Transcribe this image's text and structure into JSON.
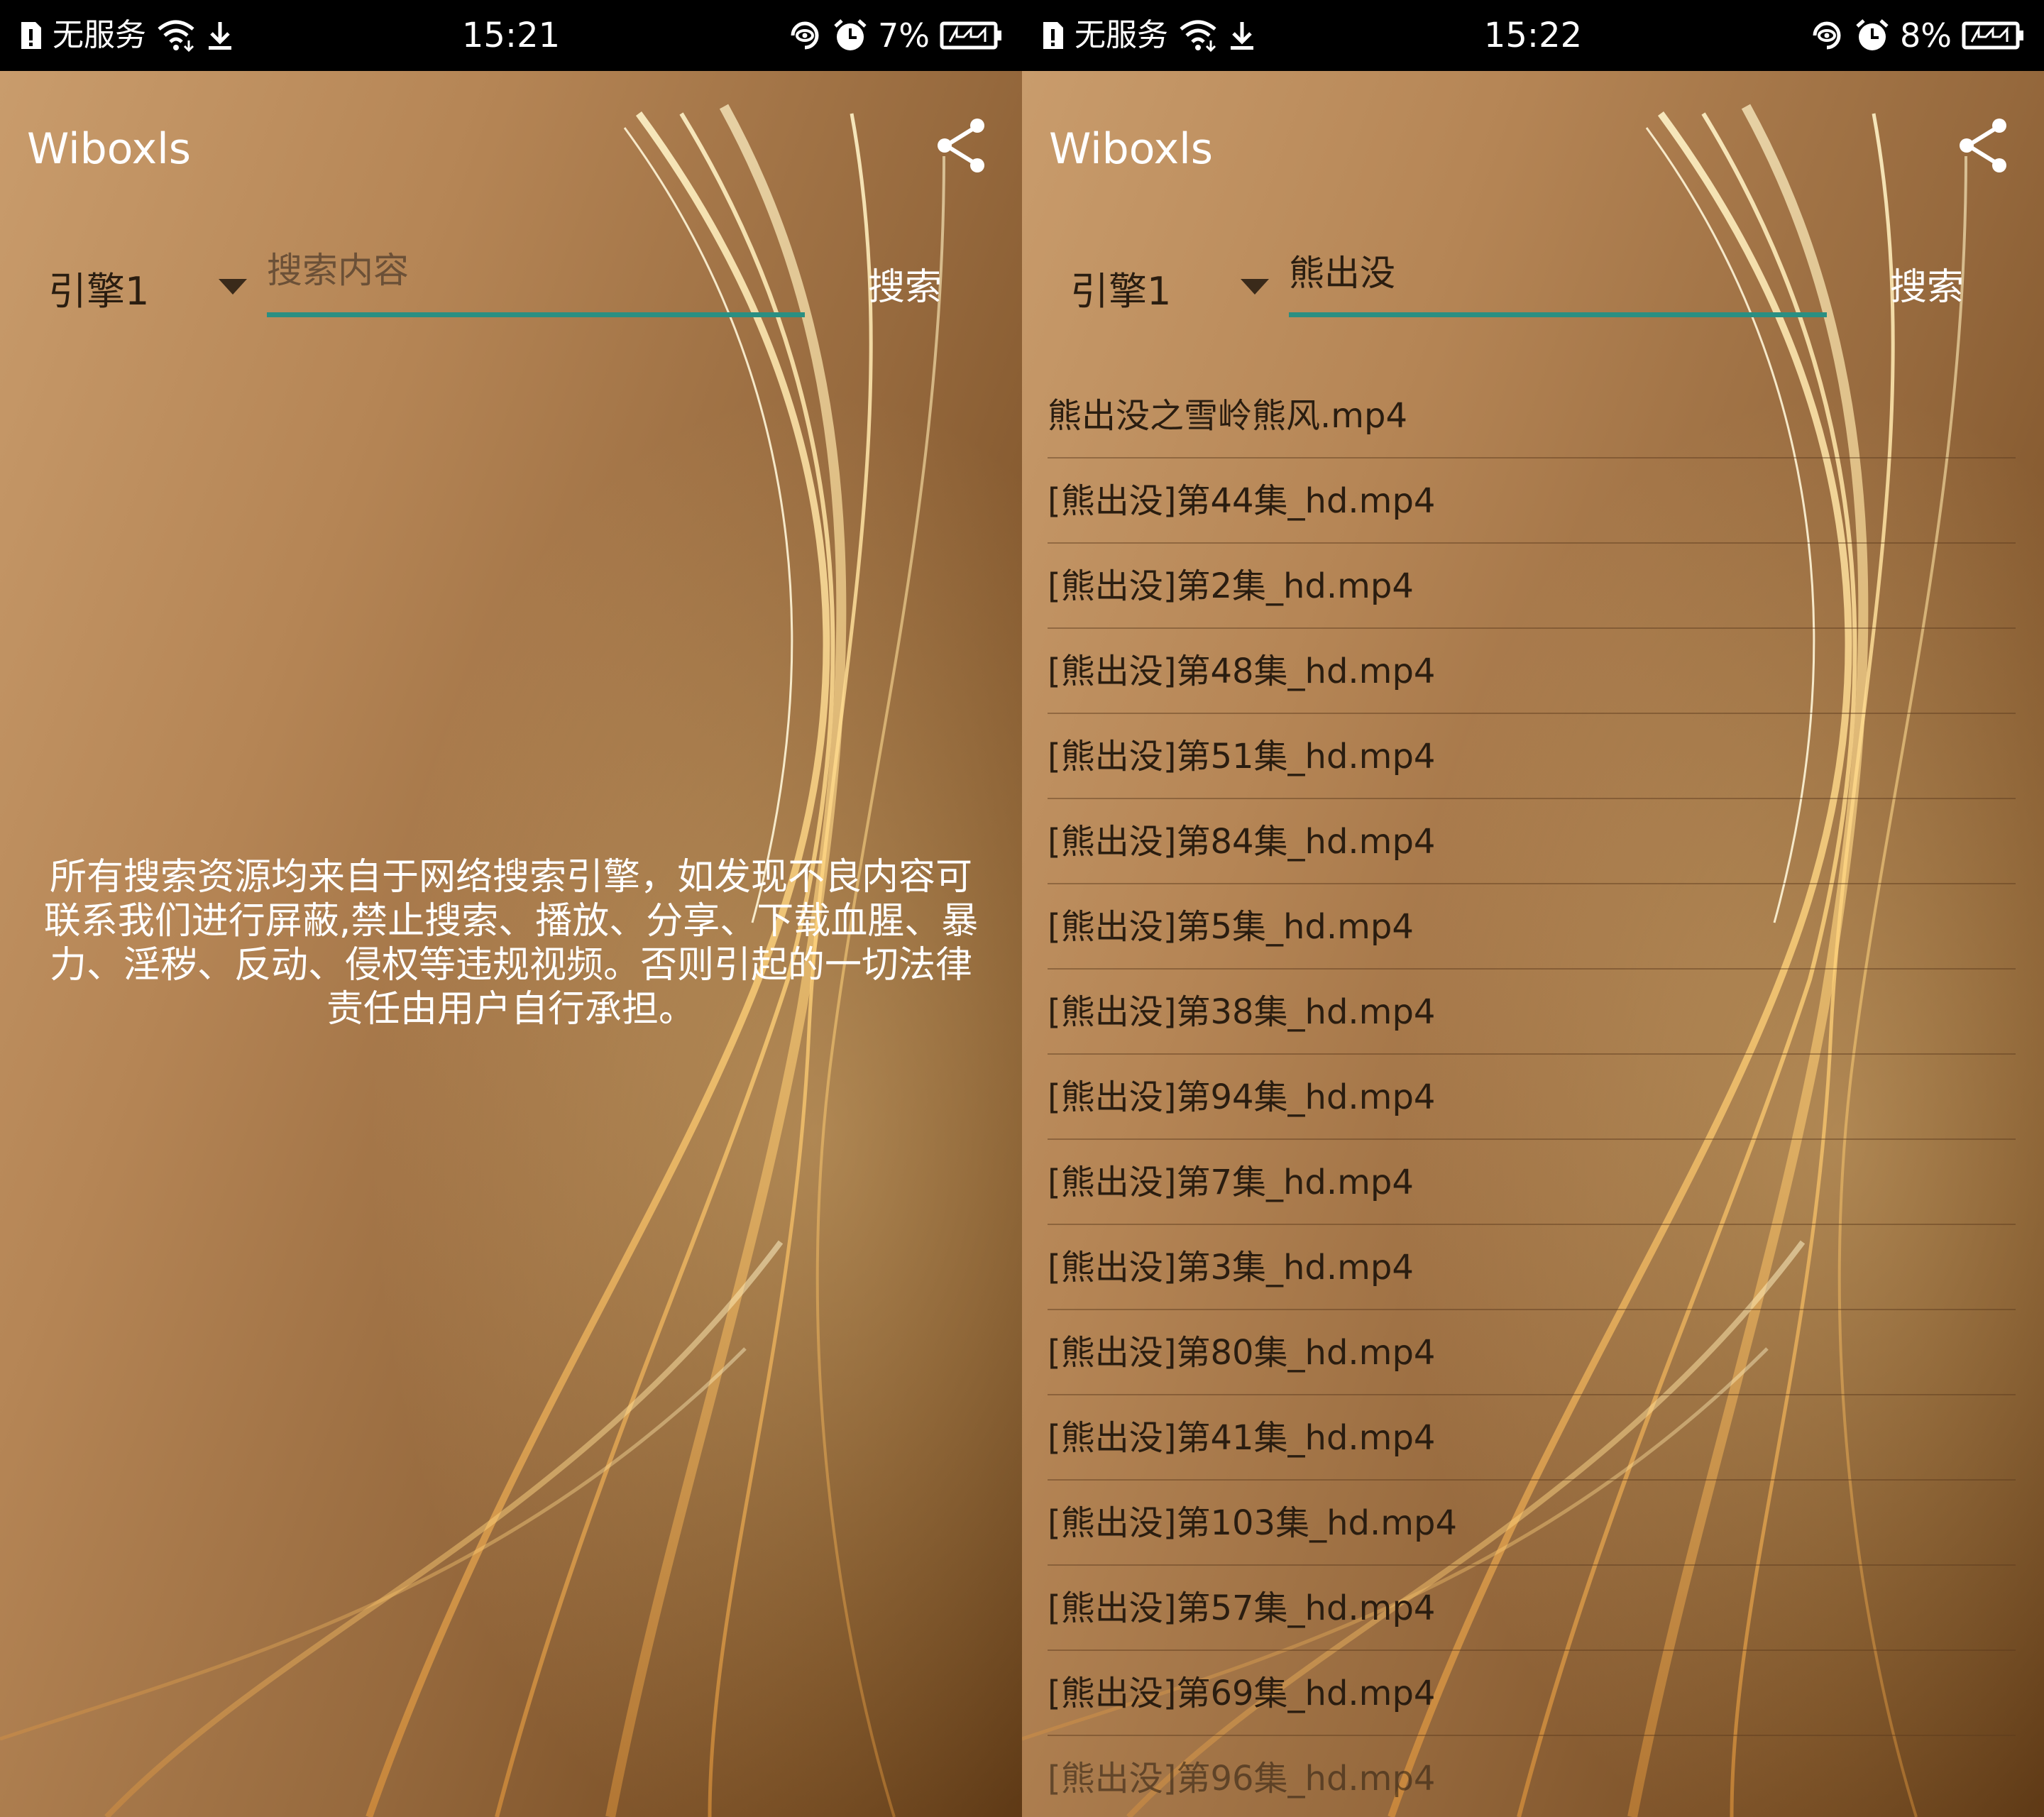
{
  "left": {
    "status": {
      "carrier": "无服务",
      "time": "15:21",
      "battery": "7%"
    },
    "app_title": "Wiboxls",
    "engine": "引擎1",
    "search": {
      "value": "",
      "placeholder": "搜索内容",
      "button": "搜索"
    },
    "notice": "所有搜索资源均来自于网络搜索引擎，如发现不良内容可联系我们进行屏蔽,禁止搜索、播放、分享、下载血腥、暴力、淫秽、反动、侵权等违规视频。否则引起的一切法律责任由用户自行承担。"
  },
  "right": {
    "status": {
      "carrier": "无服务",
      "time": "15:22",
      "battery": "8%"
    },
    "app_title": "Wiboxls",
    "engine": "引擎1",
    "search": {
      "value": "熊出没",
      "placeholder": "搜索内容",
      "button": "搜索"
    },
    "results": [
      "熊出没之雪岭熊风.mp4",
      "[熊出没]第44集_hd.mp4",
      "[熊出没]第2集_hd.mp4",
      "[熊出没]第48集_hd.mp4",
      "[熊出没]第51集_hd.mp4",
      "[熊出没]第84集_hd.mp4",
      "[熊出没]第5集_hd.mp4",
      "[熊出没]第38集_hd.mp4",
      "[熊出没]第94集_hd.mp4",
      "[熊出没]第7集_hd.mp4",
      "[熊出没]第3集_hd.mp4",
      "[熊出没]第80集_hd.mp4",
      "[熊出没]第41集_hd.mp4",
      "[熊出没]第103集_hd.mp4",
      "[熊出没]第57集_hd.mp4",
      "[熊出没]第69集_hd.mp4",
      "[熊出没]第96集_hd.mp4"
    ]
  },
  "colors": {
    "accent_underline": "#2a8f82",
    "statusbar": "#000000",
    "background_brown": "#96693d"
  }
}
